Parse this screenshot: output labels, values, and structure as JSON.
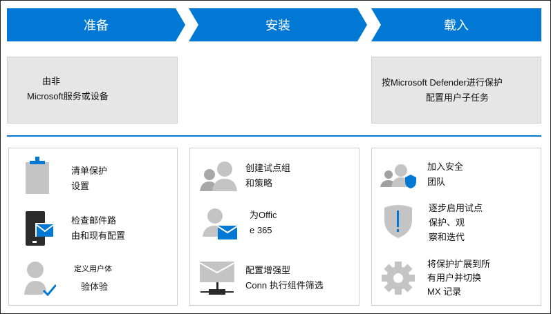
{
  "phases": [
    {
      "label": "准备"
    },
    {
      "label": "安装"
    },
    {
      "label": "载入"
    }
  ],
  "top_boxes": {
    "prepare": {
      "line1": "由非",
      "line2": "Microsoft服务或设备"
    },
    "onboard": {
      "line1": "按Microsoft Defender进行保护",
      "line2": "配置用户子任务"
    }
  },
  "panels": {
    "prepare": [
      {
        "icon": "clipboard-icon",
        "line1": "清单保护",
        "line2": "设置"
      },
      {
        "icon": "phone-mail-icon",
        "line1": "检查邮件路",
        "line2": "由和现有配置"
      },
      {
        "icon": "user-check-icon",
        "line1": "定义用户体",
        "line2": "验体验"
      }
    ],
    "setup": [
      {
        "icon": "users-icon",
        "line1": "创建试点组",
        "line2": "和策略"
      },
      {
        "icon": "user-mail-icon",
        "line1": "为Offic",
        "line2": "e 365"
      },
      {
        "icon": "mail-network-icon",
        "line1": "配置增强型",
        "line2": "Conn 执行组件筛选"
      }
    ],
    "onboard": [
      {
        "icon": "users-shield-icon",
        "line1": "加入安全",
        "line2": "团队"
      },
      {
        "icon": "shield-alert-icon",
        "line1": "逐步启用试点",
        "line2": "保护、观",
        "line3": "察和迭代"
      },
      {
        "icon": "gear-icon",
        "line1": "将保护扩展到所",
        "line2": "有用户并切换",
        "line3": "MX 记录"
      }
    ]
  },
  "colors": {
    "accent": "#0078d4",
    "icon_gray": "#c4c4c4",
    "dark": "#2b2b2b"
  }
}
